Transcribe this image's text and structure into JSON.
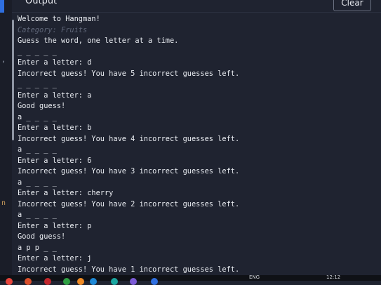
{
  "header": {
    "title": "Output",
    "clear_label": "Clear"
  },
  "edge": {
    "comma": ",",
    "n": "n"
  },
  "console": {
    "lines": [
      "Welcome to Hangman!",
      "Category: Fruits",
      "Guess the word, one letter at a time.",
      "_ _ _ _ _",
      "Enter a letter: d",
      "Incorrect guess! You have 5 incorrect guesses left.",
      "_ _ _ _ _",
      "Enter a letter: a",
      "Good guess!",
      "a _ _ _ _",
      "Enter a letter: b",
      "Incorrect guess! You have 4 incorrect guesses left.",
      "a _ _ _ _",
      "Enter a letter: 6",
      "Incorrect guess! You have 3 incorrect guesses left.",
      "a _ _ _ _",
      "Enter a letter: cherry",
      "Incorrect guess! You have 2 incorrect guesses left.",
      "a _ _ _ _",
      "Enter a letter: p",
      "Good guess!",
      "a p p _ _",
      "Enter a letter: j",
      "Incorrect guess! You have 1 incorrect guesses left."
    ]
  },
  "taskbar": {
    "lang": "ENG",
    "time": "12:12",
    "icons": [
      {
        "name": "chrome-icon",
        "color": "#e8453c"
      },
      {
        "name": "office-icon",
        "color": "#d94f2b"
      },
      {
        "name": "app-icon-red",
        "color": "#c2272d"
      },
      {
        "name": "app-icon-green",
        "color": "#2ea043"
      },
      {
        "name": "app-icon-orange",
        "color": "#f08a24"
      },
      {
        "name": "edge-icon",
        "color": "#1e88d6"
      },
      {
        "name": "app-icon-teal",
        "color": "#1aa6a0"
      },
      {
        "name": "app-icon-purple",
        "color": "#7b5ad6"
      },
      {
        "name": "app-icon-blue",
        "color": "#2f6fe0"
      }
    ]
  }
}
